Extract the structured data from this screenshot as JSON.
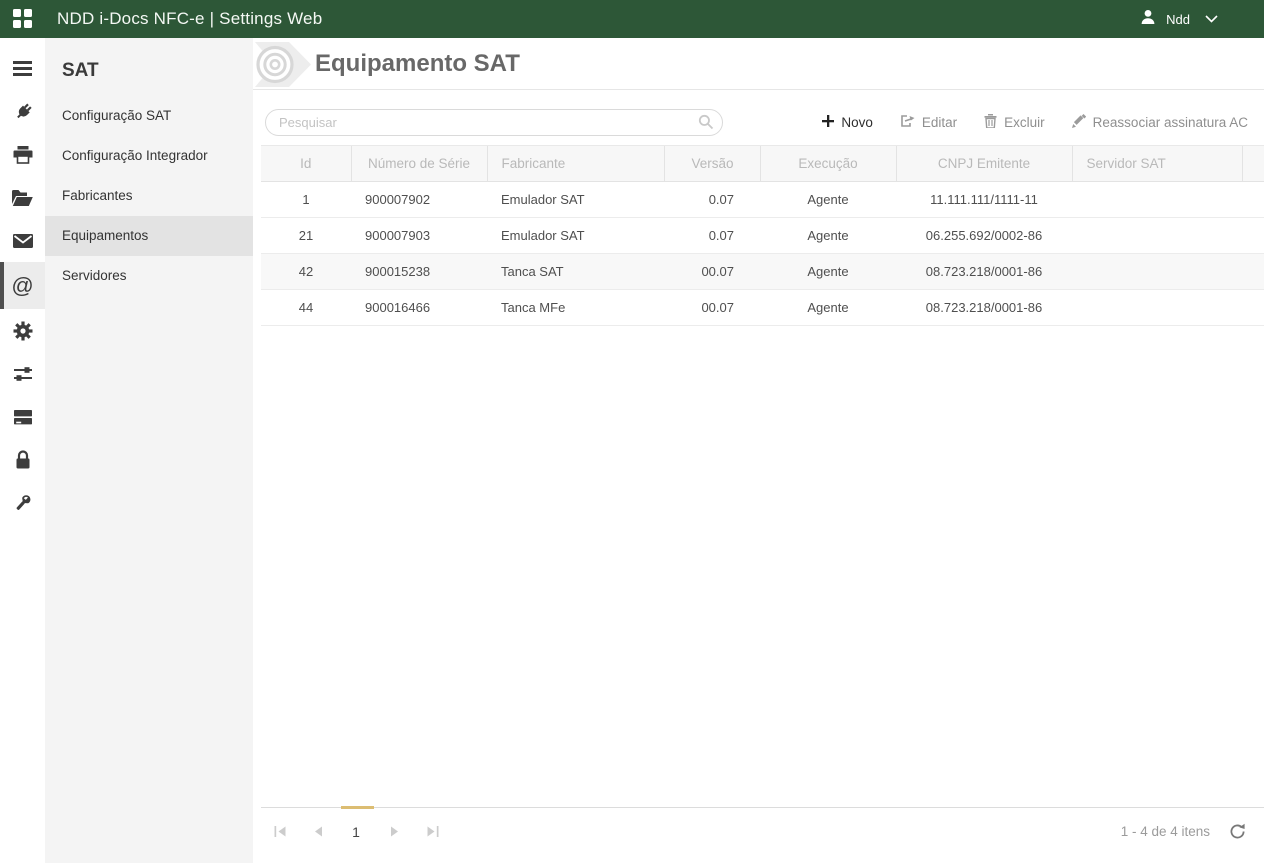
{
  "colors": {
    "topbar_green": "#2d5737",
    "pager_accent": "#dcbd72",
    "rail_icon": "#3d3d3d",
    "disabled_action": "#8f8f8f"
  },
  "topbar": {
    "title": "NDD i-Docs NFC-e | Settings Web",
    "user_name": "Ndd",
    "icons": {
      "app_logo": "grid-squares",
      "user": "person-icon",
      "menu": "chevron-down-icon"
    }
  },
  "icon_rail": {
    "items": [
      {
        "icon": "hamburger-menu-icon",
        "selected": false
      },
      {
        "icon": "plug-icon",
        "selected": false
      },
      {
        "icon": "printer-icon",
        "selected": false
      },
      {
        "icon": "folder-open-icon",
        "selected": false
      },
      {
        "icon": "envelope-icon",
        "selected": false
      },
      {
        "icon": "at-sign-icon",
        "selected": true
      },
      {
        "icon": "gear-icon",
        "selected": false
      },
      {
        "icon": "sliders-icon",
        "selected": false
      },
      {
        "icon": "server-icon",
        "selected": false
      },
      {
        "icon": "lock-icon",
        "selected": false
      },
      {
        "icon": "wrench-icon",
        "selected": false
      }
    ]
  },
  "sidebar": {
    "title": "SAT",
    "items": [
      {
        "label": "Configuração SAT",
        "selected": false
      },
      {
        "label": "Configuração Integrador",
        "selected": false
      },
      {
        "label": "Fabricantes",
        "selected": false
      },
      {
        "label": "Equipamentos",
        "selected": true
      },
      {
        "label": "Servidores",
        "selected": false
      }
    ]
  },
  "main": {
    "title": "Equipamento SAT",
    "search": {
      "placeholder": "Pesquisar",
      "value": "",
      "icon": "search-icon"
    },
    "toolbar": {
      "novo": "Novo",
      "editar": "Editar",
      "excluir": "Excluir",
      "reassociar": "Reassociar assinatura AC",
      "icons": {
        "novo": "plus-icon",
        "editar": "edit-arrow-box-icon",
        "excluir": "trash-icon",
        "reassociar": "pencil-icon"
      }
    },
    "table": {
      "columns": [
        "Id",
        "Número de Série",
        "Fabricante",
        "Versão",
        "Execução",
        "CNPJ Emitente",
        "Servidor SAT"
      ],
      "rows": [
        [
          "1",
          "900007902",
          "Emulador SAT",
          "0.07",
          "Agente",
          "11.111.111/1111-11",
          ""
        ],
        [
          "21",
          "900007903",
          "Emulador SAT",
          "0.07",
          "Agente",
          "06.255.692/0002-86",
          ""
        ],
        [
          "42",
          "900015238",
          "Tanca SAT",
          "00.07",
          "Agente",
          "08.723.218/0001-86",
          ""
        ],
        [
          "44",
          "900016466",
          "Tanca MFe",
          "00.07",
          "Agente",
          "08.723.218/0001-86",
          ""
        ]
      ]
    },
    "pager": {
      "current_page": "1",
      "status": "1 - 4 de 4 itens",
      "icons": {
        "first": "first-page-icon",
        "prev": "prev-page-icon",
        "next": "next-page-icon",
        "last": "last-page-icon",
        "refresh": "refresh-icon"
      }
    }
  }
}
